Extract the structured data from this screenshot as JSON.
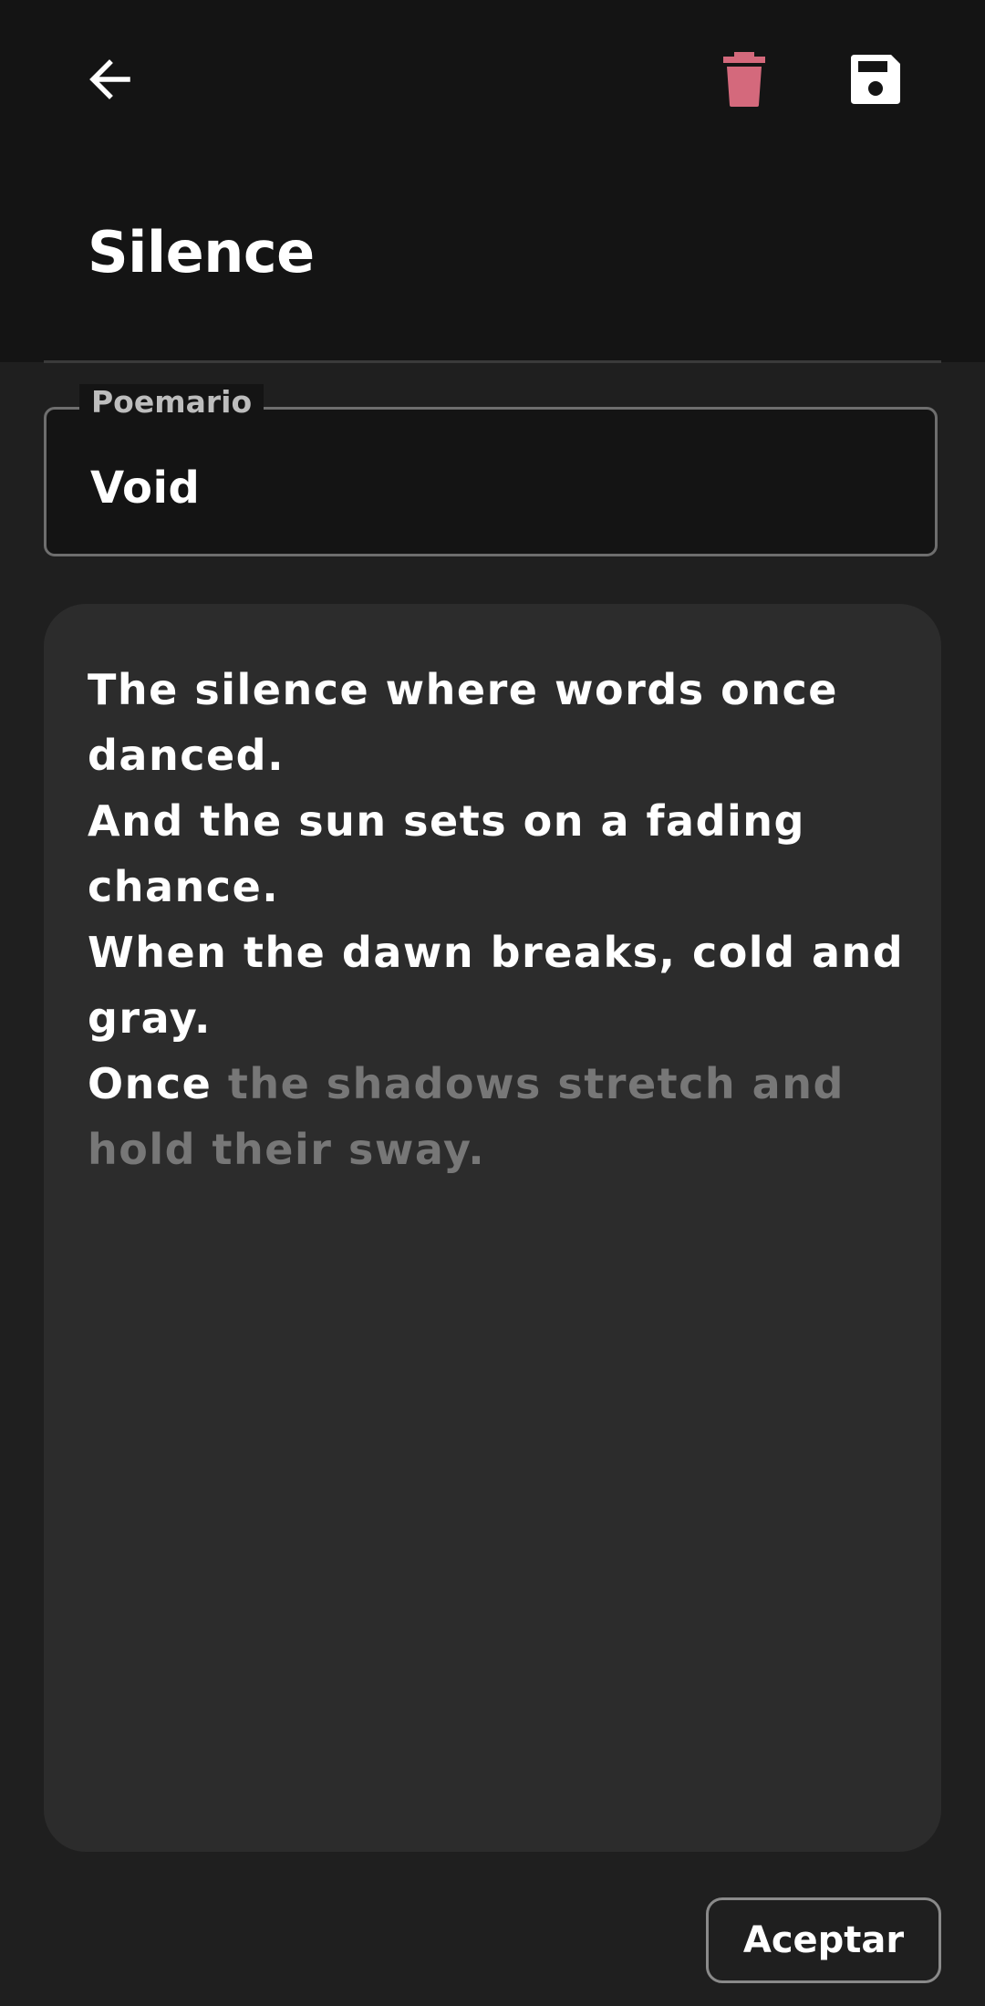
{
  "header": {
    "back_icon": "arrow-left-icon",
    "delete_icon": "trash-icon",
    "save_icon": "floppy-disk-icon"
  },
  "title": "Silence",
  "poemario": {
    "label": "Poemario",
    "value": "Void"
  },
  "poem": {
    "lines": [
      "The silence where words once danced.",
      "And the sun sets on a fading chance.",
      "When the dawn breaks, cold and gray."
    ],
    "typed_partial": "Once ",
    "suggestion": "the shadows stretch and hold their sway."
  },
  "actions": {
    "accept_label": "Aceptar"
  },
  "colors": {
    "background": "#1f1f1f",
    "header_background": "#141414",
    "editor_background": "#2c2c2c",
    "delete_icon": "#d4697c",
    "suggestion_text": "#777777"
  }
}
